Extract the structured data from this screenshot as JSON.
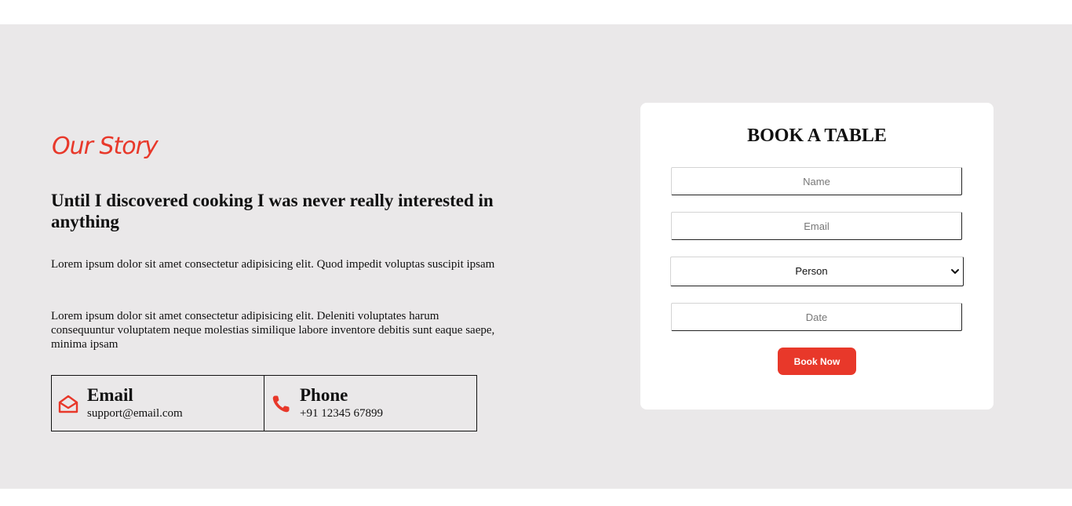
{
  "story": {
    "title": "Our Story",
    "heading": "Until I discovered cooking I was never really interested in anything",
    "paragraphs": [
      "Lorem ipsum dolor sit amet consectetur adipisicing elit. Quod impedit voluptas suscipit ipsam",
      "Lorem ipsum dolor sit amet consectetur adipisicing elit. Deleniti voluptates harum consequuntur voluptatem neque molestias similique labore inventore debitis sunt eaque saepe, minima ipsam"
    ]
  },
  "contact": [
    {
      "label": "Email",
      "value": "support@email.com",
      "icon": "envelope-open-icon"
    },
    {
      "label": "Phone",
      "value": "+91 12345 67899",
      "icon": "phone-icon"
    }
  ],
  "booking": {
    "title": "BOOK A TABLE",
    "name_placeholder": "Name",
    "email_placeholder": "Email",
    "person_selected": "Person",
    "date_placeholder": "Date",
    "button_label": "Book Now"
  },
  "colors": {
    "accent": "#e8382a",
    "section_bg": "#eae8e9",
    "card_bg": "#ffffff"
  }
}
